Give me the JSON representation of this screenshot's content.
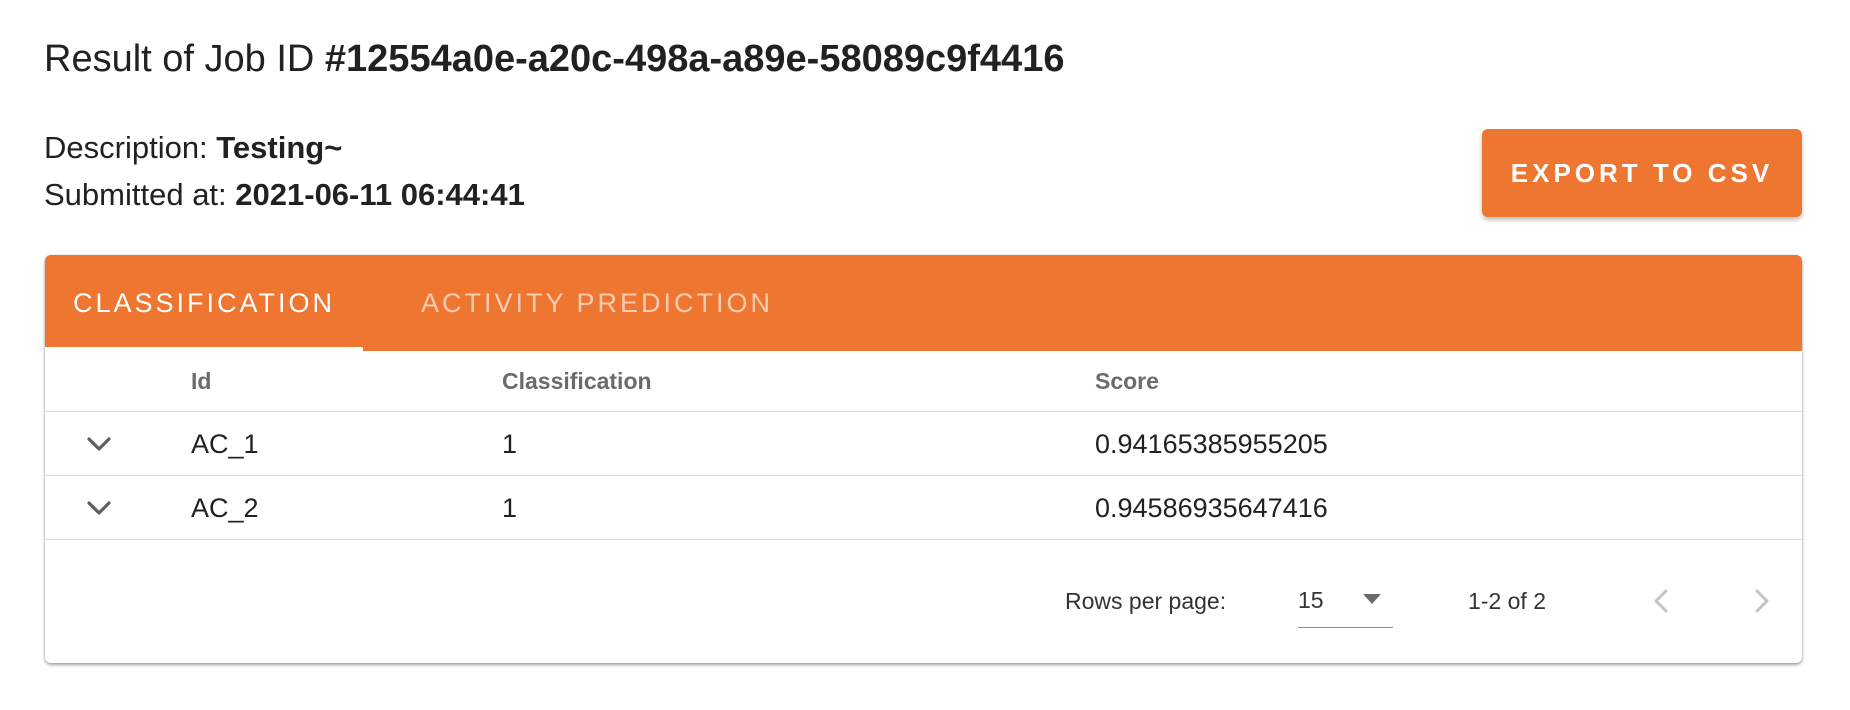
{
  "header": {
    "title_prefix": "Result of Job ID ",
    "job_id": "#12554a0e-a20c-498a-a89e-58089c9f4416",
    "description_label": "Description: ",
    "description_value": "Testing~",
    "submitted_label": "Submitted at: ",
    "submitted_value": "2021-06-11 06:44:41"
  },
  "actions": {
    "export_label": "EXPORT TO CSV"
  },
  "tabs": [
    {
      "label": "CLASSIFICATION",
      "active": true
    },
    {
      "label": "ACTIVITY PREDICTION",
      "active": false
    }
  ],
  "table": {
    "columns": [
      "Id",
      "Classification",
      "Score"
    ],
    "rows": [
      {
        "id": "AC_1",
        "classification": "1",
        "score": "0.94165385955205"
      },
      {
        "id": "AC_2",
        "classification": "1",
        "score": "0.94586935647416"
      }
    ]
  },
  "pagination": {
    "rows_per_page_label": "Rows per page:",
    "rows_per_page_value": "15",
    "range_text": "1-2 of 2"
  },
  "icons": {
    "expand": "chevron-down-icon",
    "select_caret": "caret-down-icon",
    "prev": "chevron-left-icon",
    "next": "chevron-right-icon"
  },
  "colors": {
    "accent": "#ef7630",
    "text": "#212121",
    "header_text": "#6b6b6b"
  }
}
